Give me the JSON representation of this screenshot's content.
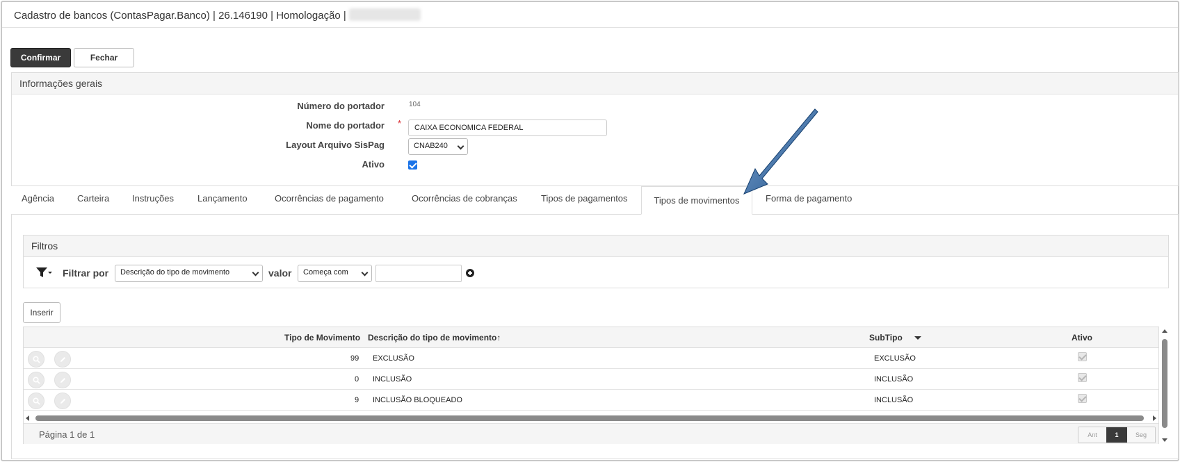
{
  "window": {
    "title": "Cadastro de bancos (ContasPagar.Banco) | 26.146190 | Homologação |"
  },
  "toolbar": {
    "confirm_label": "Confirmar",
    "close_label": "Fechar"
  },
  "general_info": {
    "heading": "Informações gerais",
    "portador_number_label": "Número do portador",
    "portador_number_value": "104",
    "portador_name_label": "Nome do portador",
    "portador_name_required_mark": "*",
    "portador_name_value": "CAIXA ECONOMICA FEDERAL",
    "layout_label": "Layout Arquivo SisPag",
    "layout_value": "CNAB240",
    "active_label": "Ativo",
    "active_checked": true
  },
  "tabs": [
    {
      "label": "Agência"
    },
    {
      "label": "Carteira"
    },
    {
      "label": "Instruções"
    },
    {
      "label": "Lançamento"
    },
    {
      "label": "Ocorrências de pagamento"
    },
    {
      "label": "Ocorrências de cobranças"
    },
    {
      "label": "Tipos de pagamentos"
    },
    {
      "label": "Tipos de movimentos",
      "active": true
    },
    {
      "label": "Forma de pagamento"
    }
  ],
  "filters": {
    "heading": "Filtros",
    "filter_by_label": "Filtrar por",
    "filter_field_value": "Descrição do tipo de movimento",
    "value_label": "valor",
    "operator_value": "Começa com",
    "text_value": ""
  },
  "insert_label": "Inserir",
  "grid": {
    "columns": {
      "tipo": "Tipo de Movimento",
      "descricao": "Descrição do tipo de movimento",
      "subtipo": "SubTipo",
      "ativo": "Ativo"
    },
    "sort_indicator": "↑",
    "rows": [
      {
        "tipo": "99",
        "descricao": "EXCLUSÃO",
        "subtipo": "EXCLUSÃO",
        "ativo": true
      },
      {
        "tipo": "0",
        "descricao": "INCLUSÃO",
        "subtipo": "INCLUSÃO",
        "ativo": true
      },
      {
        "tipo": "9",
        "descricao": "INCLUSÃO BLOQUEADO",
        "subtipo": "INCLUSÃO",
        "ativo": true
      }
    ],
    "page_info": "Página 1 de 1",
    "pager": {
      "prev": "Ant",
      "current": "1",
      "next": "Seg"
    }
  },
  "colors": {
    "primary_button": "#3a3a3a",
    "checkbox": "#1a73e8",
    "required": "#d9262c",
    "callout_arrow": "#1f4f86"
  }
}
